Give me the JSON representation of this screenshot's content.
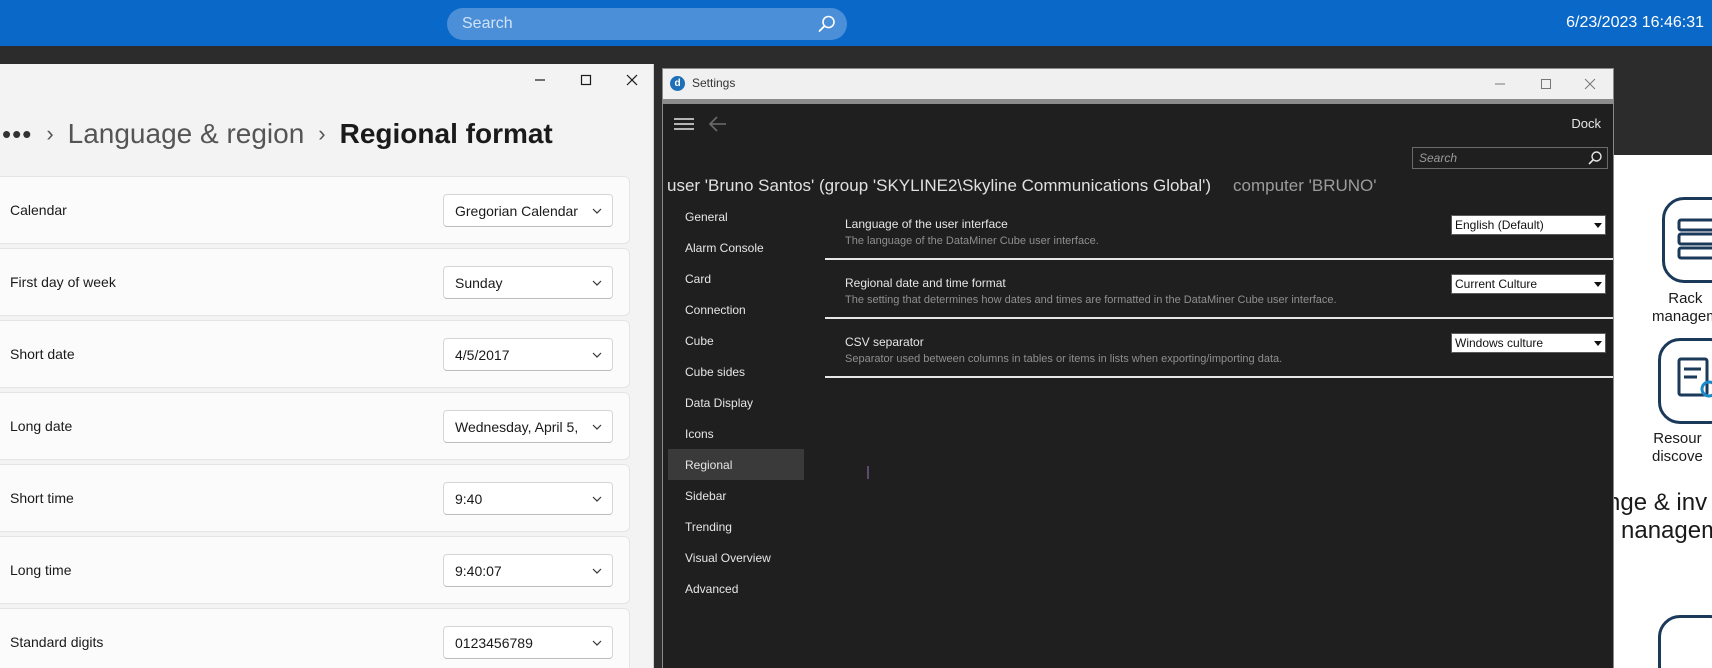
{
  "taskbar": {
    "search_placeholder": "Search",
    "clock": "6/23/2023 16:46:31"
  },
  "windows_settings": {
    "breadcrumb": {
      "ellipsis": "•••",
      "parent": "Language & region",
      "current": "Regional format"
    },
    "rows": [
      {
        "label": "Calendar",
        "value": "Gregorian Calendar"
      },
      {
        "label": "First day of week",
        "value": "Sunday"
      },
      {
        "label": "Short date",
        "value": "4/5/2017"
      },
      {
        "label": "Long date",
        "value": "Wednesday, April 5,"
      },
      {
        "label": "Short time",
        "value": "9:40"
      },
      {
        "label": "Long time",
        "value": "9:40:07"
      },
      {
        "label": "Standard digits",
        "value": "0123456789"
      }
    ]
  },
  "dataminer": {
    "title": "Settings",
    "dock_label": "Dock",
    "search_placeholder": "Search",
    "user_line": "user 'Bruno Santos' (group 'SKYLINE2\\Skyline Communications Global')",
    "computer_line": "computer 'BRUNO'",
    "nav": [
      "General",
      "Alarm Console",
      "Card",
      "Connection",
      "Cube",
      "Cube sides",
      "Data Display",
      "Icons",
      "Regional",
      "Sidebar",
      "Trending",
      "Visual Overview",
      "Advanced"
    ],
    "active_nav": "Regional",
    "settings": [
      {
        "title": "Language of the user interface",
        "desc": "The language of the DataMiner Cube user interface.",
        "value": "English (Default)"
      },
      {
        "title": "Regional date and time format",
        "desc": "The setting that determines how dates and times are formatted in the DataMiner Cube user interface.",
        "value": "Current Culture"
      },
      {
        "title": "CSV separator",
        "desc": "Separator used between columns in tables or items in lists when exporting/importing data.",
        "value": "Windows culture"
      }
    ]
  },
  "background_app": {
    "tile1_text": [
      "Rack",
      "managem"
    ],
    "tile2_text": [
      "Resour",
      "discove"
    ],
    "edge_label_1": "e",
    "section_heading": [
      "nge & inv",
      "nanagem"
    ]
  },
  "colors": {
    "taskbar": "#0a68c8",
    "dm_background": "#1f1f1f",
    "dm_active_nav": "#3a3a3a"
  }
}
